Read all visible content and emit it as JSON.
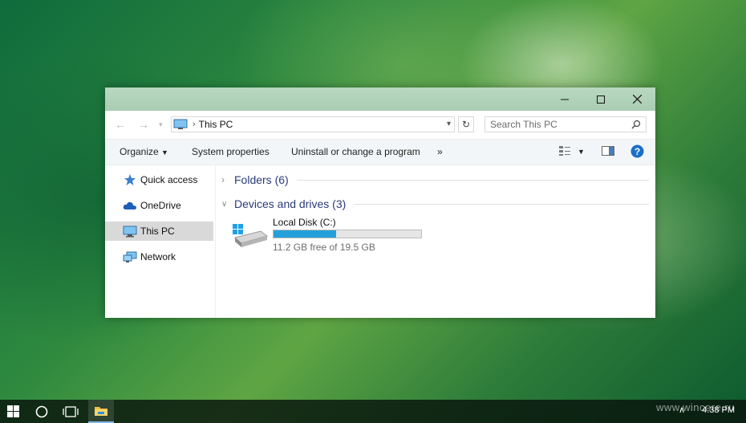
{
  "window": {
    "location": "This PC",
    "search_placeholder": "Search This PC",
    "commands": {
      "organize": "Organize",
      "system_properties": "System properties",
      "uninstall": "Uninstall or change a program",
      "more": "»"
    }
  },
  "navigation_pane": {
    "items": [
      {
        "label": "Quick access",
        "icon": "star-icon"
      },
      {
        "label": "OneDrive",
        "icon": "cloud-icon"
      },
      {
        "label": "This PC",
        "icon": "computer-icon",
        "selected": true
      },
      {
        "label": "Network",
        "icon": "network-icon"
      }
    ]
  },
  "groups": {
    "folders": "Folders (6)",
    "devices": "Devices and drives (3)"
  },
  "drive": {
    "name": "Local Disk (C:)",
    "free_text": "11.2 GB free of 19.5 GB",
    "used_fraction": 0.426
  },
  "taskbar": {
    "clock": "4:38 PM"
  },
  "watermark": "www.wincore.ru",
  "colors": {
    "accent": "#26a0da",
    "titlebar": "#b1d2b9",
    "selected_nav": "#d9d9d9"
  }
}
